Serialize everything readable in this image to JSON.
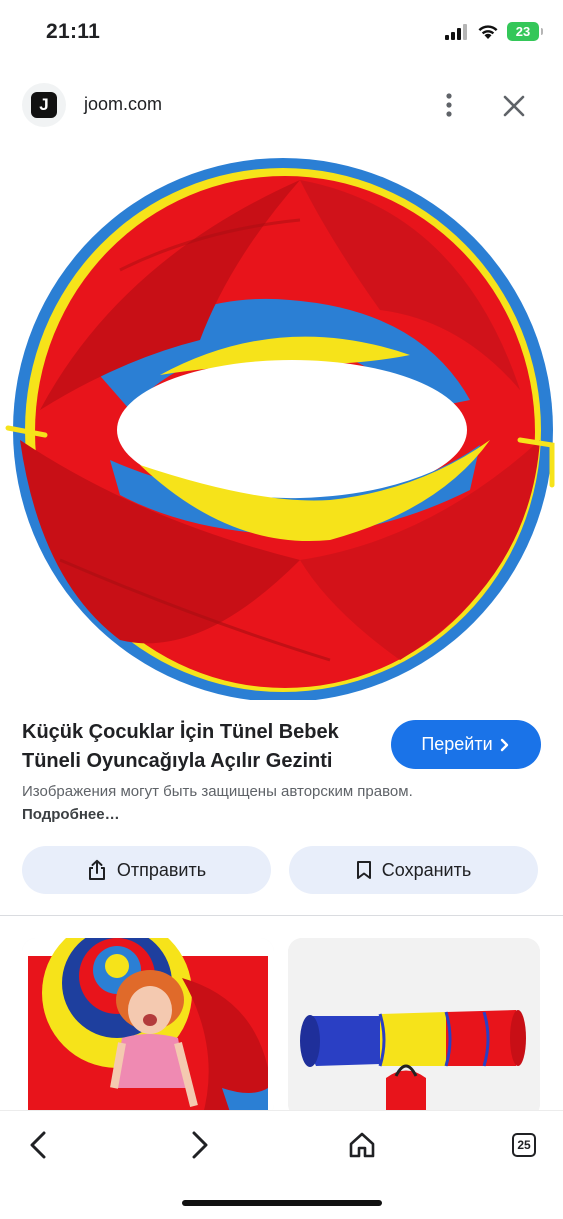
{
  "status_bar": {
    "time": "21:11",
    "battery": "23"
  },
  "site": {
    "logo_letter": "J",
    "domain": "joom.com"
  },
  "result": {
    "title": "Küçük Çocuklar İçin Tünel Bebek Tüneli Oyuncağıyla Açılır Gezinti",
    "visit_label": "Перейти",
    "copyright_text": "Изображения могут быть защищены авторским правом.",
    "more_link": "Подробнее…"
  },
  "actions": {
    "share_label": "Отправить",
    "save_label": "Сохранить"
  },
  "bottom_nav": {
    "tabs_count": "25"
  },
  "colors": {
    "accent": "#1a73e8",
    "tunnel_red": "#e8141b",
    "tunnel_yellow": "#f6e31a",
    "tunnel_blue": "#2b7fd4"
  },
  "icons": [
    "cellular-icon",
    "wifi-icon",
    "battery-icon",
    "more-icon",
    "close-icon",
    "chevron-right-icon",
    "share-icon",
    "bookmark-icon",
    "back-icon",
    "forward-icon",
    "home-icon",
    "tabs-icon"
  ]
}
